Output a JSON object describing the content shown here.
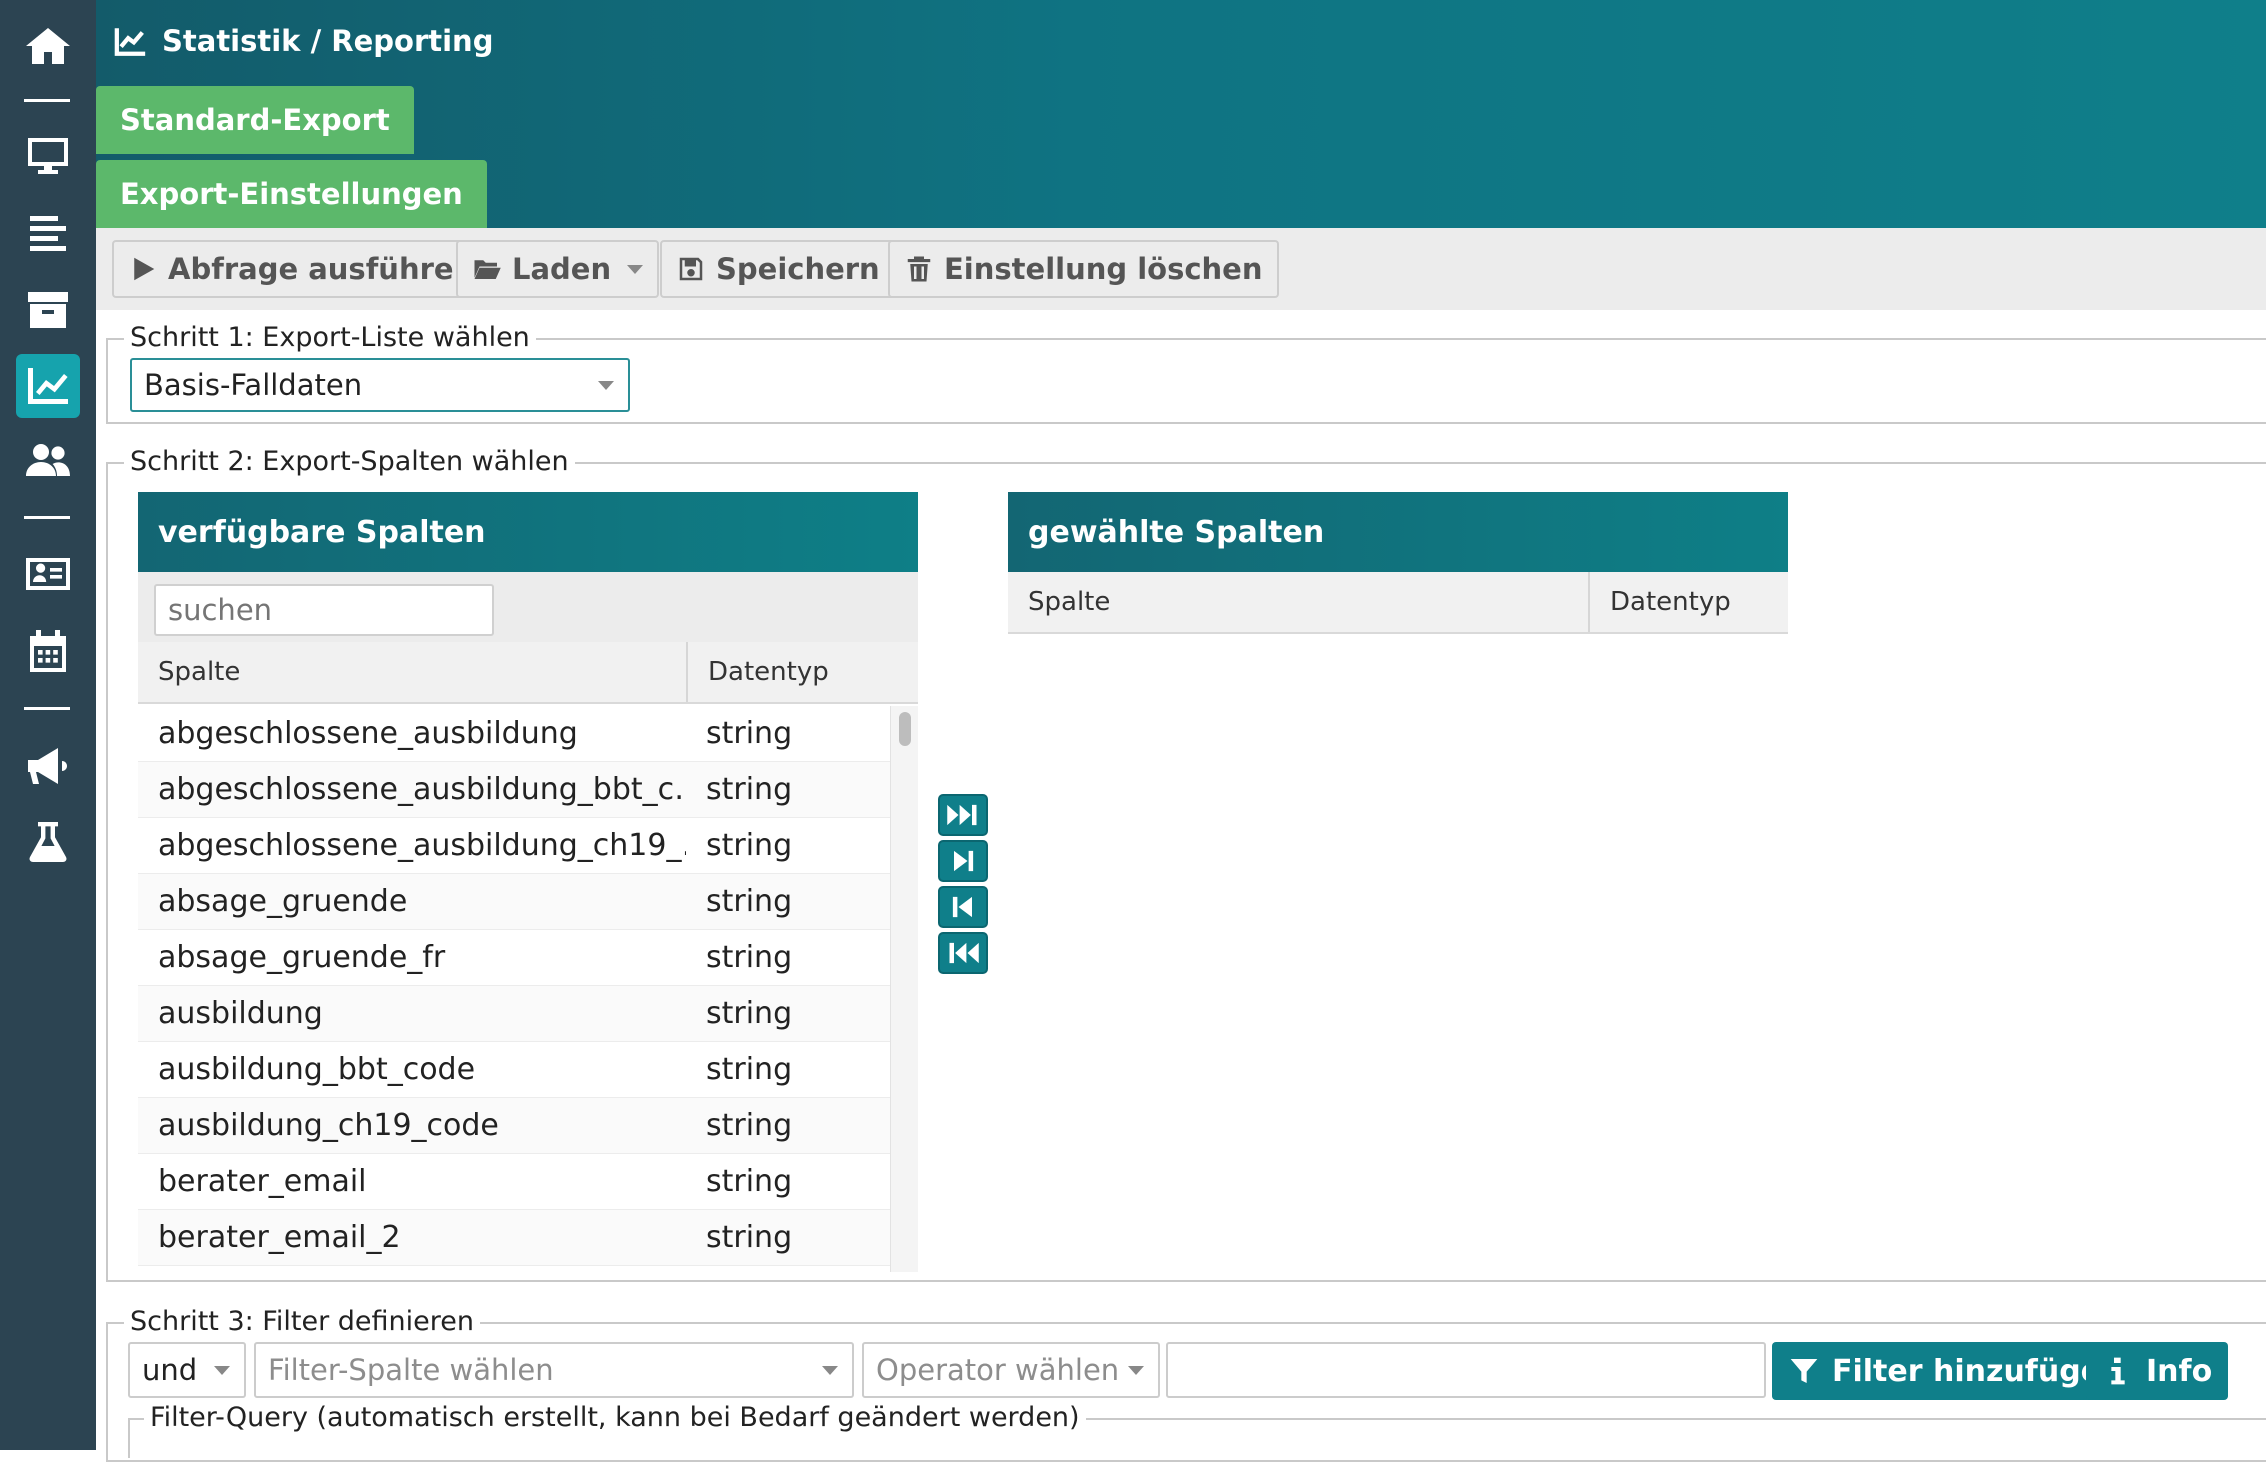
{
  "sidebar": {
    "icons": [
      "home-icon",
      "desktop-icon",
      "align-left-icon",
      "archive-icon",
      "chart-line-icon",
      "users-icon",
      "id-card-icon",
      "calendar-icon",
      "megaphone-icon",
      "flask-icon"
    ],
    "active": "chart-line-icon"
  },
  "header": {
    "title": "Statistik / Reporting",
    "tabs": [
      "Standard-Export",
      "Export-Einstellungen"
    ]
  },
  "toolbar": {
    "run_label": "Abfrage ausführen",
    "load_label": "Laden",
    "save_label": "Speichern",
    "delete_label": "Einstellung löschen"
  },
  "step1": {
    "legend": "Schritt 1: Export-Liste wählen",
    "selected": "Basis-Falldaten"
  },
  "step2": {
    "legend": "Schritt 2: Export-Spalten wählen",
    "available": {
      "title": "verfügbare Spalten",
      "search_placeholder": "suchen",
      "col_name": "Spalte",
      "col_type": "Datentyp",
      "rows": [
        {
          "name": "abgeschlossene_ausbildung",
          "type": "string"
        },
        {
          "name": "abgeschlossene_ausbildung_bbt_c…",
          "type": "string"
        },
        {
          "name": "abgeschlossene_ausbildung_ch19_…",
          "type": "string"
        },
        {
          "name": "absage_gruende",
          "type": "string"
        },
        {
          "name": "absage_gruende_fr",
          "type": "string"
        },
        {
          "name": "ausbildung",
          "type": "string"
        },
        {
          "name": "ausbildung_bbt_code",
          "type": "string"
        },
        {
          "name": "ausbildung_ch19_code",
          "type": "string"
        },
        {
          "name": "berater_email",
          "type": "string"
        },
        {
          "name": "berater_email_2",
          "type": "string"
        }
      ]
    },
    "selected": {
      "title": "gewählte Spalten",
      "col_name": "Spalte",
      "col_type": "Datentyp"
    }
  },
  "step3": {
    "legend": "Schritt 3: Filter definieren",
    "logic_value": "und",
    "column_placeholder": "Filter-Spalte wählen",
    "operator_placeholder": "Operator wählen",
    "value": "",
    "add_filter_label": "Filter hinzufügen",
    "info_label": "Info",
    "query_legend": "Filter-Query (automatisch erstellt, kann bei Bedarf geändert werden)"
  },
  "colors": {
    "sidebar": "#2c4452",
    "accent": "#0f7f8a",
    "tab_green": "#5cb86b",
    "active_icon": "#16a3ad"
  }
}
